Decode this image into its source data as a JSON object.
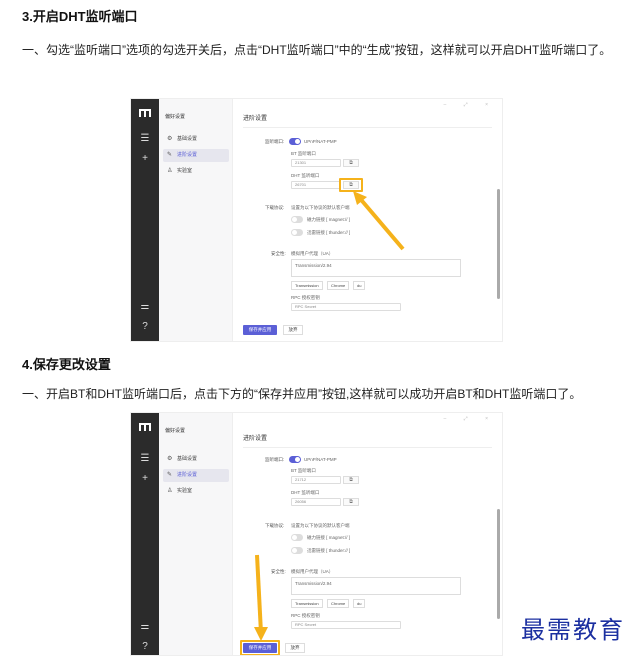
{
  "sections": [
    {
      "heading": "3.开启DHT监听端口",
      "paragraph": "一、勾选“监听端口”选项的勾选开关后，点击“DHT监听端口”中的“生成”按钮，这样就可以开启DHT监听端口了。"
    },
    {
      "heading": "4.保存更改设置",
      "paragraph": "一、开启BT和DHT监听端口后，点击下方的“保存并应用”按钮,这样就可以成功开启BT和DHT监听端口了。"
    }
  ],
  "app": {
    "sidebar_title": "偏好设置",
    "nav": [
      "基础设置",
      "进阶设置",
      "实验室"
    ],
    "content_title": "进阶设置",
    "listen_label": "监听端口:",
    "listen_toggle_text": "UPnP/NAT-PMP",
    "bt_label": "BT 监听端口",
    "dht_label": "DHT 监听端口",
    "download_label": "下载协议:",
    "download_desc": "设置为以下协议的默认客户端",
    "magnet": "磁力链接 [ magnet:// ]",
    "thunder": "迅雷链接 [ thunder:// ]",
    "security_label": "安全性:",
    "ua_label": "模拟用户代理（UA）",
    "ua_value": "Transmission/2.94",
    "ua_chips": [
      "Transmission",
      "Chrome",
      "du"
    ],
    "rpc_label": "RPC 授权密钥",
    "rpc_placeholder": "RPC Secret",
    "save_button": "保存并应用",
    "cancel_button": "放弃"
  },
  "shot1": {
    "bt_port": "21301",
    "dht_port": "26701"
  },
  "shot2": {
    "bt_port": "21712",
    "dht_port": "26056"
  },
  "watermark": "最需教育",
  "colors": {
    "accent": "#5b5fd6",
    "highlight": "#f5b21b",
    "rail": "#2b2b2b",
    "watermark": "#1b2fa0"
  }
}
